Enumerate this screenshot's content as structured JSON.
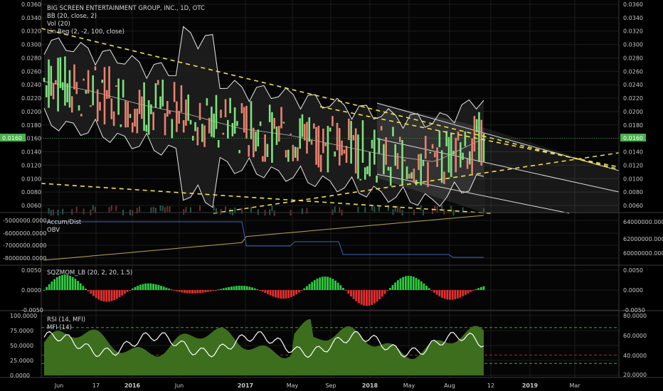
{
  "price_pane": {
    "title": "BIG SCREEN ENTERTAINMENT GROUP, INC., 1D, OTC",
    "indicators": [
      "BB (20, close, 2)",
      "Vol (20)",
      "Lin Reg (2, -2, 100, close)"
    ],
    "y_ticks": [
      "0.0360",
      "0.0340",
      "0.0320",
      "0.0300",
      "0.0280",
      "0.0260",
      "0.0240",
      "0.0220",
      "0.0200",
      "0.0180",
      "0.0160",
      "0.0140",
      "0.0120",
      "0.0100",
      "0.0080",
      "0.0060"
    ],
    "last_price": "0.0160"
  },
  "accum_pane": {
    "title": "Accum/Dist",
    "subtitle": "OBV",
    "left_ticks": [
      "-5000000.0000",
      "-6000000.0000",
      "-7000000.0000",
      "-8000000.0000"
    ],
    "right_ticks": [
      "64000000.0000",
      "62000000.0000",
      "60000000.0000"
    ]
  },
  "sqz_pane": {
    "title": "SQZMOM_LB (20, 2, 20, 1.5)",
    "left_ticks": [
      "0.0050",
      "0.0000",
      "-0.0050"
    ],
    "right_ticks": [
      "0.0050",
      "0.0000",
      "-0.0050"
    ]
  },
  "rsi_pane": {
    "title": "RSI (14, MFI)",
    "subtitle": "MFI (14)",
    "left_ticks": [
      "100.0000",
      "75.0000",
      "50.0000",
      "25.0000",
      "0.0000"
    ],
    "right_ticks": [
      "80.0000",
      "60.0000",
      "40.0000",
      "20.0000"
    ]
  },
  "x_axis": {
    "ticks": [
      "Jun",
      "17",
      "2016",
      "Jun",
      "2017",
      "May",
      "Sep",
      "2018",
      "May",
      "Aug",
      "12",
      "2019",
      "Mar"
    ]
  },
  "colors": {
    "up": "#7ee07e",
    "down": "#e8826f",
    "trend": "#f0e04a",
    "price_badge": "#4caf50",
    "obv": "#3a63b8",
    "accdist": "#b8a84a",
    "mfi_fill": "#3d6e1e",
    "mom_pos": "#2ecc40",
    "mom_neg": "#e53030"
  },
  "chart_data": {
    "type": "line",
    "title": "BIG SCREEN ENTERTAINMENT GROUP, INC., 1D, OTC",
    "x": [
      "Jun",
      "17",
      "2016",
      "Jun",
      "2017",
      "May",
      "Sep",
      "2018",
      "May",
      "Aug"
    ],
    "ylim": [
      0.005,
      0.036
    ],
    "series": [
      {
        "values": [
          0.0245,
          0.023,
          0.021,
          0.0195,
          0.0175,
          0.0165,
          0.015,
          0.0135,
          0.0125,
          0.016
        ]
      }
    ],
    "last_price": 0.016
  }
}
